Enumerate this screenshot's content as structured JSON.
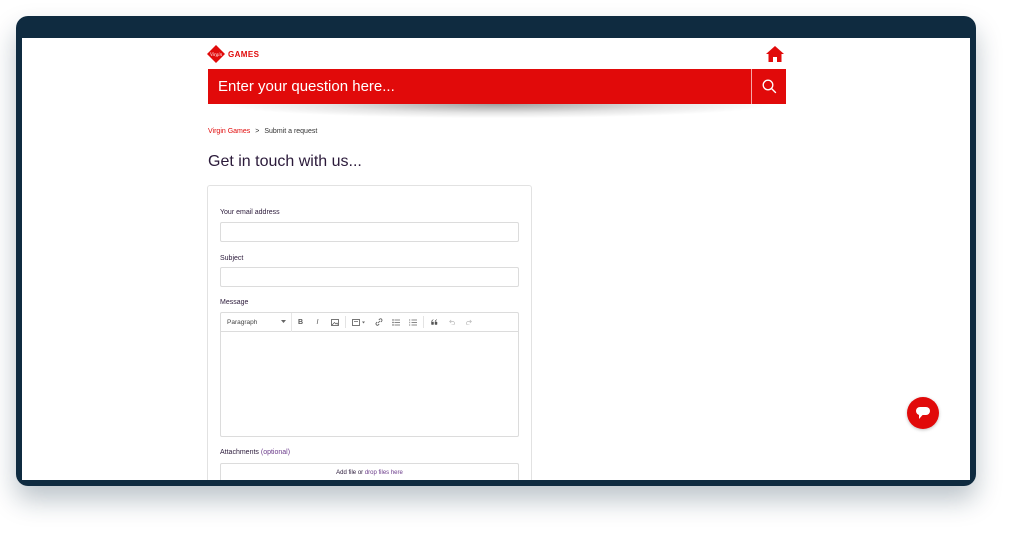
{
  "header": {
    "logo_text": "GAMES",
    "logo_script": "Virgin",
    "search_placeholder": "Enter your question here..."
  },
  "breadcrumb": {
    "home": "Virgin Games",
    "separator": ">",
    "current": "Submit a request"
  },
  "page_title": "Get in touch with us...",
  "form": {
    "email_label": "Your email address",
    "subject_label": "Subject",
    "message_label": "Message",
    "editor": {
      "paragraph_label": "Paragraph",
      "bold": "B",
      "italic": "I"
    },
    "attachments_label": "Attachments",
    "attachments_optional": "(optional)",
    "add_file": "Add file",
    "or": "or",
    "drop_files": "drop files here"
  },
  "colors": {
    "brand": "#e10a0a",
    "frame": "#0f2b40",
    "text": "#2b1a3a"
  },
  "icons": [
    "virgin-logo-icon",
    "home-icon",
    "search-icon",
    "chat-icon"
  ]
}
